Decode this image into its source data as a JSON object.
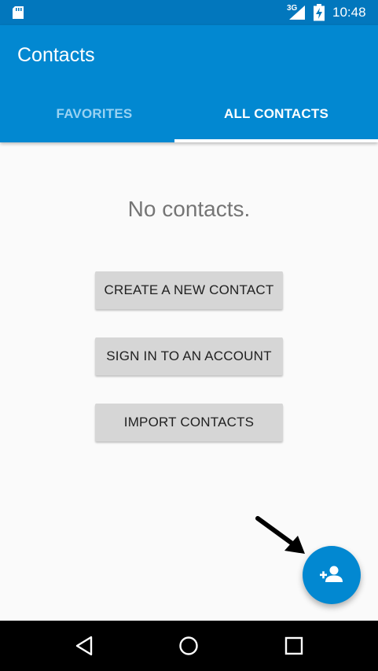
{
  "status_bar": {
    "network": "3G",
    "time": "10:48"
  },
  "app_bar": {
    "title": "Contacts",
    "tabs": [
      {
        "label": "FAVORITES",
        "selected": false
      },
      {
        "label": "ALL CONTACTS",
        "selected": true
      }
    ]
  },
  "main": {
    "empty_message": "No contacts.",
    "buttons": [
      {
        "label": "CREATE A NEW CONTACT"
      },
      {
        "label": "SIGN IN TO AN ACCOUNT"
      },
      {
        "label": "IMPORT CONTACTS"
      }
    ]
  },
  "fab": {
    "icon": "add-person-icon"
  },
  "nav_bar": {
    "icons": [
      "back-icon",
      "home-icon",
      "recents-icon"
    ]
  },
  "colors": {
    "primary": "#0288d1",
    "primary_dark": "#0277bd",
    "background": "#fafafa",
    "button": "#d6d6d6"
  }
}
